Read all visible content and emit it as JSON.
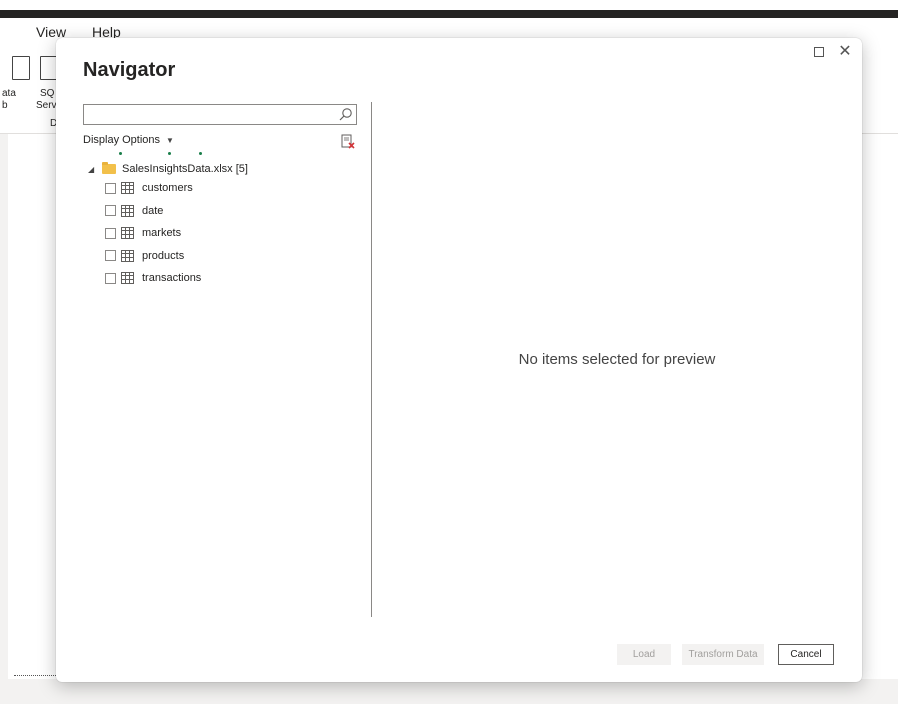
{
  "app": {
    "menu": [
      "View",
      "Help"
    ],
    "ribbon_left": {
      "btn1_line1": "ata",
      "btn1_line2": "b",
      "btn2_line1": "SQ",
      "btn2_line2": "Serv",
      "group_label": "D"
    }
  },
  "dialog": {
    "title": "Navigator",
    "search": {
      "value": "",
      "placeholder": ""
    },
    "display_options_label": "Display Options",
    "tree": {
      "root_label": "SalesInsightsData.xlsx [5]",
      "items": [
        {
          "label": "customers",
          "checked": false
        },
        {
          "label": "date",
          "checked": false
        },
        {
          "label": "markets",
          "checked": false
        },
        {
          "label": "products",
          "checked": false
        },
        {
          "label": "transactions",
          "checked": false
        }
      ]
    },
    "preview_message": "No items selected for preview",
    "buttons": {
      "load": "Load",
      "transform": "Transform Data",
      "cancel": "Cancel"
    }
  },
  "icons": {
    "search": "search-icon",
    "refresh": "refresh-icon",
    "folder": "folder-icon",
    "table": "table-icon",
    "maximize": "maximize-icon",
    "close": "close-icon"
  },
  "colors": {
    "folder": "#f2c04a",
    "accent_dot": "#1a7f4a",
    "dark_band": "#252423"
  }
}
